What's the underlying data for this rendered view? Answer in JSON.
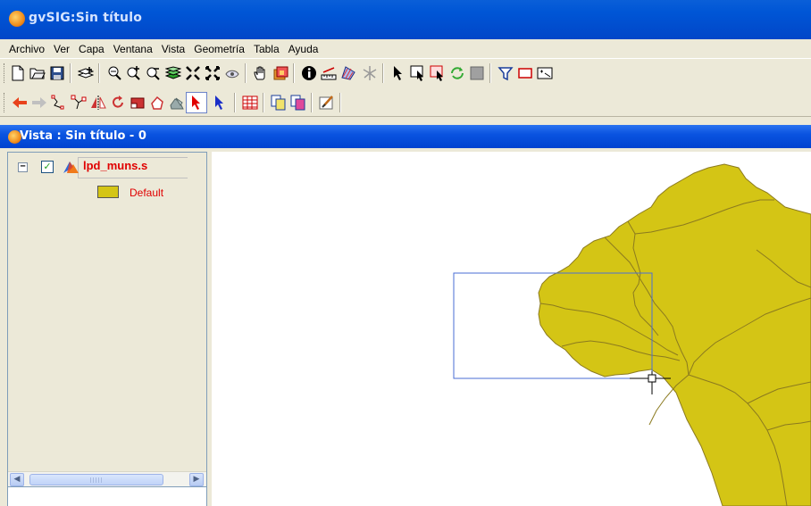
{
  "window": {
    "title": "gvSIG:Sin título",
    "logo_icon": "gvsig-logo-icon"
  },
  "menubar": {
    "items": [
      "Archivo",
      "Ver",
      "Capa",
      "Ventana",
      "Vista",
      "Geometría",
      "Tabla",
      "Ayuda"
    ]
  },
  "toolbar": {
    "row1_icons": [
      "new-document-icon",
      "open-folder-icon",
      "save-icon",
      "add-layer-icon",
      "zoom-previous-icon",
      "zoom-in-icon",
      "zoom-out-icon",
      "zoom-all-layers-icon",
      "zoom-select-icon",
      "zoom-full-icon",
      "zoom-back-icon",
      "pan-hand-icon",
      "layer-order-icon",
      "info-icon",
      "measure-distance-icon",
      "measure-area-icon",
      "hyperlink-icon",
      "select-arrow-icon",
      "select-rectangle-icon",
      "select-polygon-icon",
      "select-by-layer-icon",
      "invert-selection-icon",
      "filter-icon",
      "rectangle-icon",
      "zoom-to-selection-icon"
    ],
    "row2_icons": [
      "undo-arrow-icon",
      "redo-arrow-icon",
      "polyline-icon",
      "edit-vertex-icon",
      "symmetry-icon",
      "rotate-icon",
      "scale-icon",
      "polygon-icon",
      "join-icon",
      "edit-select-arrow-icon",
      "edit-complex-select-icon",
      "table-icon",
      "copy-icon",
      "paste-icon",
      "edit-brush-icon"
    ],
    "pressed_tool": "edit-select-arrow-icon"
  },
  "view": {
    "title": "Vista : Sin título - 0"
  },
  "toc": {
    "layer": {
      "name": "lpd_muns.s",
      "checked": true,
      "legend_label": "Default",
      "fill_color": "#d4c515"
    }
  },
  "colors": {
    "titlebar": "#0056d6",
    "map_fill": "#d4c515",
    "map_border": "#8b7a1f",
    "selection_rect": "#4a6ed6",
    "layer_label": "#e00000"
  }
}
